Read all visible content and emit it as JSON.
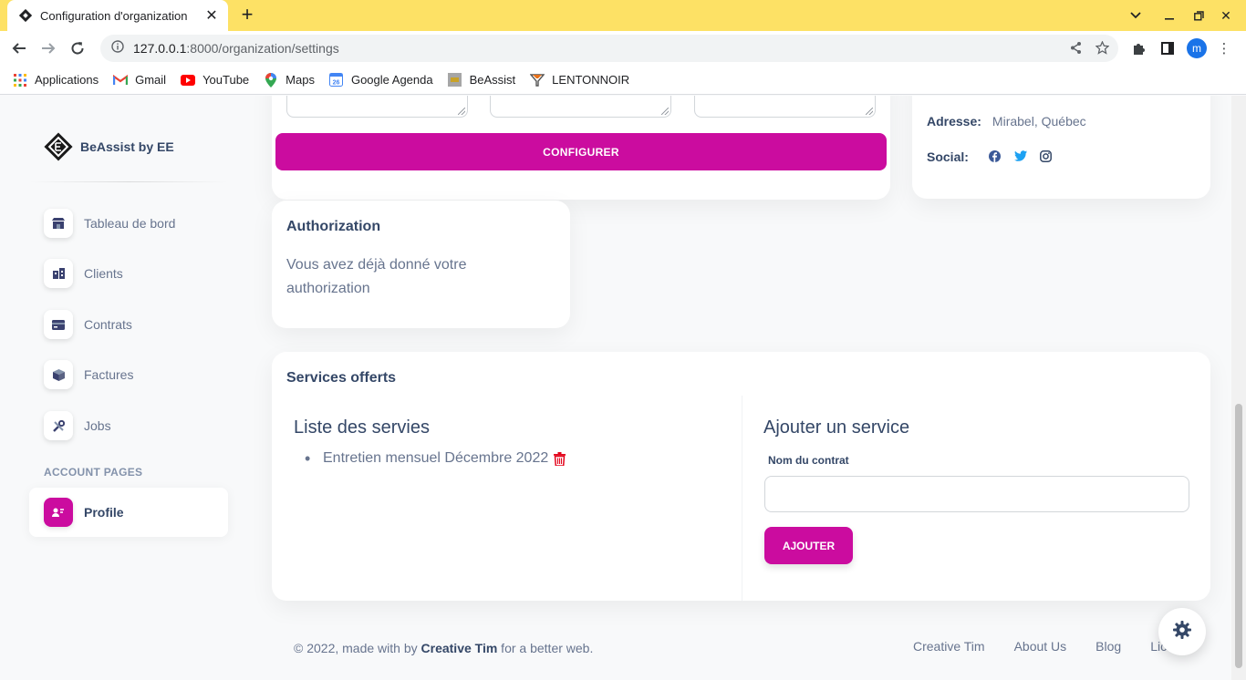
{
  "browser": {
    "tab_title": "Configuration d'organization",
    "url_host": "127.0.0.1",
    "url_path": ":8000/organization/settings",
    "profile_initial": "m",
    "bookmarks": [
      {
        "label": "Applications",
        "icon": "apps-grid-icon"
      },
      {
        "label": "Gmail",
        "icon": "gmail-icon"
      },
      {
        "label": "YouTube",
        "icon": "youtube-icon"
      },
      {
        "label": "Maps",
        "icon": "maps-pin-icon"
      },
      {
        "label": "Google Agenda",
        "icon": "calendar-icon"
      },
      {
        "label": "BeAssist",
        "icon": "beassist-icon"
      },
      {
        "label": "LENTONNOIR",
        "icon": "lentonnoir-icon"
      }
    ]
  },
  "sidebar": {
    "brand": "BeAssist by EE",
    "items": [
      {
        "label": "Tableau de bord",
        "icon": "shop-icon"
      },
      {
        "label": "Clients",
        "icon": "office-icon"
      },
      {
        "label": "Contrats",
        "icon": "credit-card-icon"
      },
      {
        "label": "Factures",
        "icon": "box-3d-icon"
      },
      {
        "label": "Jobs",
        "icon": "settings-tools-icon"
      }
    ],
    "section_label": "ACCOUNT PAGES",
    "profile": {
      "label": "Profile",
      "icon": "customer-support-icon"
    }
  },
  "config_card": {
    "button_label": "CONFIGURER"
  },
  "info_card": {
    "address_label": "Adresse:",
    "address_value": "Mirabel, Québec",
    "social_label": "Social:",
    "social_icons": [
      "facebook-icon",
      "twitter-icon",
      "instagram-icon"
    ]
  },
  "auth_card": {
    "title": "Authorization",
    "text": "Vous avez déjà donné votre authorization"
  },
  "services_card": {
    "title": "Services offerts",
    "list_title": "Liste des servies",
    "services": [
      "Entretien mensuel Décembre 2022"
    ],
    "add_title": "Ajouter un service",
    "field_label": "Nom du contrat",
    "field_value": "",
    "add_button": "AJOUTER"
  },
  "footer": {
    "copyright_prefix": "© 2022, made with by ",
    "brand": "Creative Tim",
    "copyright_suffix": " for a better web.",
    "links": [
      "Creative Tim",
      "About Us",
      "Blog",
      "Licen"
    ]
  },
  "colors": {
    "accent": "#cb0c9f",
    "tab_strip": "#fde165",
    "text_dark": "#344767",
    "text_muted": "#67748e"
  }
}
